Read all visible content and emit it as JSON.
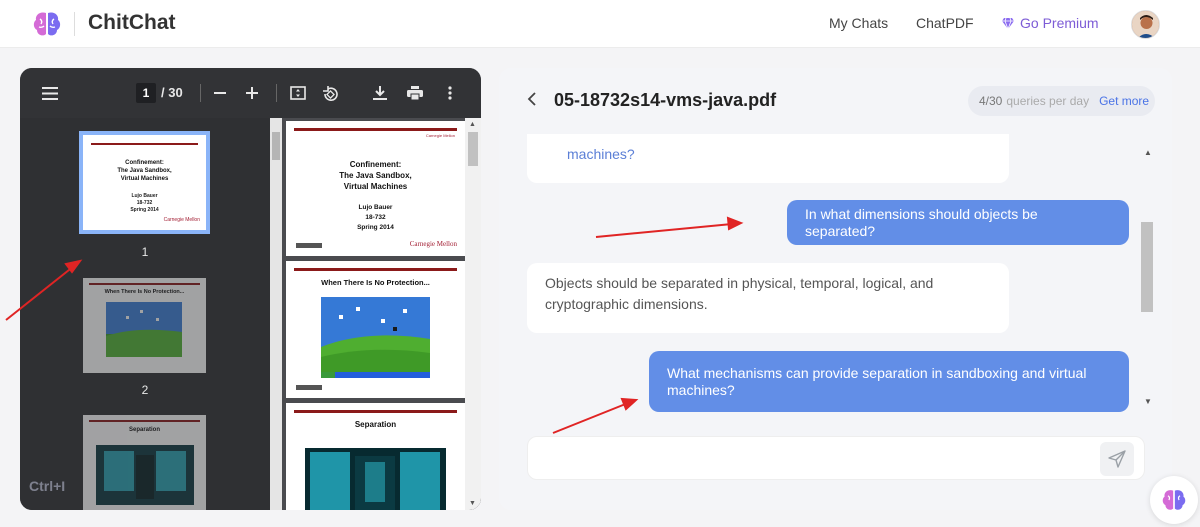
{
  "header": {
    "brand": "ChitChat",
    "nav": {
      "my_chats": "My Chats",
      "chat_pdf": "ChatPDF",
      "go_premium": "Go Premium"
    },
    "accent_color": "#7d5cd6"
  },
  "viewer": {
    "current_page": "1",
    "page_total": "/ 30",
    "toolbar_icons": [
      "menu-icon",
      "zoom-out-icon",
      "zoom-in-icon",
      "fit-page-icon",
      "rotate-icon",
      "download-icon",
      "print-icon",
      "more-icon"
    ],
    "thumbnails": [
      {
        "number": "1",
        "title": "Confinement:\nThe Java Sandbox,\nVirtual Machines",
        "lines": [
          "Lujo Bauer",
          "18-732",
          "Spring 2014"
        ]
      },
      {
        "number": "2",
        "title": "When There Is No Protection..."
      },
      {
        "title": "Separation"
      }
    ],
    "pages": [
      {
        "title_lines": [
          "Confinement:",
          "The Java Sandbox,",
          "Virtual Machines"
        ],
        "lines": [
          "Lujo Bauer",
          "18-732",
          "Spring 2014"
        ],
        "footer": "Carnegie Mellon"
      },
      {
        "title": "When There Is No Protection..."
      },
      {
        "title": "Separation"
      }
    ],
    "watermark": "Ctrl+I"
  },
  "chat": {
    "file_name": "05-18732s14-vms-java.pdf",
    "quota": {
      "used": "4/30",
      "label": "queries per day",
      "action": "Get more"
    },
    "messages": [
      {
        "role": "bot",
        "text": "machines?"
      },
      {
        "role": "user",
        "text": "In what dimensions should objects be separated?"
      },
      {
        "role": "bot",
        "text": "Objects should be separated in physical, temporal, logical, and cryptographic dimensions."
      },
      {
        "role": "user",
        "text": "What mechanisms can provide separation in sandboxing and virtual machines?"
      }
    ],
    "input": {
      "value": "",
      "placeholder": ""
    },
    "user_bubble_color": "#628ee7",
    "link_color": "#5b7fd6"
  }
}
